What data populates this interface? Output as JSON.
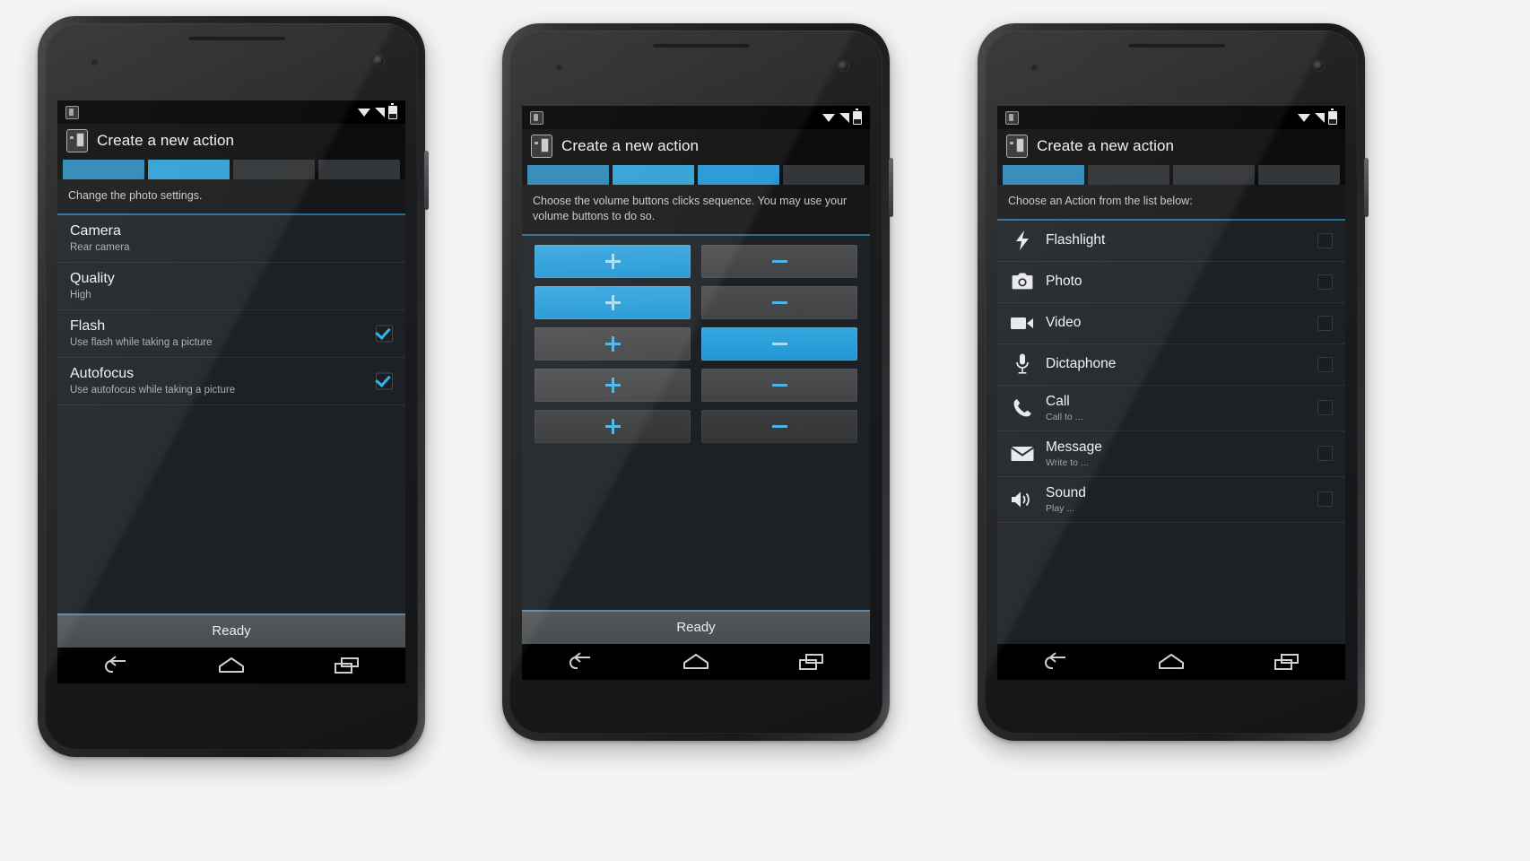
{
  "page": {
    "background": "#f4f4f4",
    "accent": "#2196d4"
  },
  "statusbar": {
    "app_icon": "app-window-icon",
    "wifi_icon": "wifi-icon",
    "signal_icon": "cellular-signal-icon",
    "battery_icon": "battery-icon"
  },
  "navbar": {
    "back": "back-icon",
    "home": "home-icon",
    "recents": "recents-icon"
  },
  "phones": [
    {
      "id": "phone-photo-settings",
      "action_bar": {
        "title": "Create a new action",
        "icon": "phone-action-icon"
      },
      "steps": {
        "total": 4,
        "completed": 2,
        "colors": [
          "#2b86b5",
          "#2f9fd6",
          "#2e3133",
          "#34373a"
        ]
      },
      "hint": "Change the photo settings.",
      "rows": [
        {
          "title": "Camera",
          "subtitle": "Rear camera",
          "checkbox": false,
          "checked": false
        },
        {
          "title": "Quality",
          "subtitle": "High",
          "checkbox": false,
          "checked": false
        },
        {
          "title": "Flash",
          "subtitle": "Use flash while taking a picture",
          "checkbox": true,
          "checked": true
        },
        {
          "title": "Autofocus",
          "subtitle": "Use autofocus while taking a picture",
          "checkbox": true,
          "checked": true
        }
      ],
      "ready_label": "Ready"
    },
    {
      "id": "phone-volume-sequence",
      "action_bar": {
        "title": "Create a new action",
        "icon": "phone-action-icon"
      },
      "steps": {
        "total": 4,
        "completed": 3,
        "colors": [
          "#2b86b5",
          "#2f9fd6",
          "#2196d4",
          "#34373a"
        ]
      },
      "hint": "Choose the volume buttons clicks sequence. You may use your volume buttons to do so.",
      "volume_rows": [
        {
          "plus_label": "+",
          "minus_label": "–",
          "selected": "plus"
        },
        {
          "plus_label": "+",
          "minus_label": "–",
          "selected": "plus"
        },
        {
          "plus_label": "+",
          "minus_label": "–",
          "selected": "minus"
        },
        {
          "plus_label": "+",
          "minus_label": "–",
          "selected": "none"
        },
        {
          "plus_label": "+",
          "minus_label": "–",
          "selected": "none"
        }
      ],
      "ready_label": "Ready"
    },
    {
      "id": "phone-action-list",
      "action_bar": {
        "title": "Create a new action",
        "icon": "phone-action-icon"
      },
      "steps": {
        "total": 4,
        "completed": 1,
        "colors": [
          "#2b86b5",
          "#2b2e31",
          "#2e3134",
          "#34373a"
        ]
      },
      "hint": "Choose an Action from the list below:",
      "actions": [
        {
          "title": "Flashlight",
          "subtitle": "",
          "icon": "flashlight-icon",
          "checked": false
        },
        {
          "title": "Photo",
          "subtitle": "",
          "icon": "camera-icon",
          "checked": false
        },
        {
          "title": "Video",
          "subtitle": "",
          "icon": "video-icon",
          "checked": false
        },
        {
          "title": "Dictaphone",
          "subtitle": "",
          "icon": "microphone-icon",
          "checked": false
        },
        {
          "title": "Call",
          "subtitle": "Call to ...",
          "icon": "phone-call-icon",
          "checked": false
        },
        {
          "title": "Message",
          "subtitle": "Write to ...",
          "icon": "envelope-icon",
          "checked": false
        },
        {
          "title": "Sound",
          "subtitle": "Play ...",
          "icon": "speaker-icon",
          "checked": false
        }
      ]
    }
  ]
}
